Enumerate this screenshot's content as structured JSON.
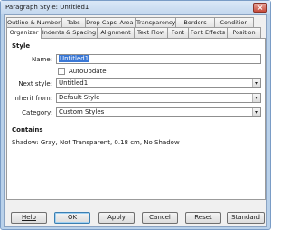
{
  "window": {
    "title": "Paragraph Style: Untitled1",
    "close_glyph": "×"
  },
  "tabs_row1": [
    "Outline & Numbering",
    "Tabs",
    "Drop Caps",
    "Area",
    "Transparency",
    "Borders",
    "Condition"
  ],
  "tabs_row2": [
    "Organizer",
    "Indents & Spacing",
    "Alignment",
    "Text Flow",
    "Font",
    "Font Effects",
    "Position"
  ],
  "active_tab": "Organizer",
  "style_section": {
    "heading": "Style",
    "name_label": "Name:",
    "name_value": "Untitled1",
    "autoupdate_label": "AutoUpdate",
    "autoupdate_checked": false,
    "next_style_label": "Next style:",
    "next_style_value": "Untitled1",
    "inherit_label": "Inherit from:",
    "inherit_value": "Default Style",
    "category_label": "Category:",
    "category_value": "Custom Styles"
  },
  "contains": {
    "heading": "Contains",
    "text": "Shadow: Gray, Not Transparent, 0.18 cm, No Shadow"
  },
  "buttons": {
    "help": "Help",
    "ok": "OK",
    "apply": "Apply",
    "cancel": "Cancel",
    "reset": "Reset",
    "standard": "Standard"
  },
  "icons": {
    "close": "close-icon",
    "dropdown": "chevron-down-icon"
  }
}
